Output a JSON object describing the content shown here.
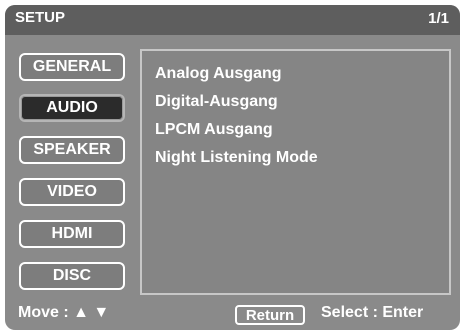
{
  "header": {
    "title": "SETUP",
    "page_indicator": "1/1"
  },
  "menu": {
    "items": [
      {
        "label": "GENERAL",
        "active": false
      },
      {
        "label": "AUDIO",
        "active": true
      },
      {
        "label": "SPEAKER",
        "active": false
      },
      {
        "label": "VIDEO",
        "active": false
      },
      {
        "label": "HDMI",
        "active": false
      },
      {
        "label": "DISC",
        "active": false
      }
    ]
  },
  "content": {
    "options": [
      "Analog Ausgang",
      "Digital-Ausgang",
      "LPCM Ausgang",
      "Night Listening Mode"
    ]
  },
  "footer": {
    "move_label": "Move : ▲ ▼",
    "return_label": "Return",
    "select_label": "Select :  Enter"
  },
  "colors": {
    "panel": "#8a8a8a",
    "titlebar": "#5e5e5e",
    "active_item": "#2b2b2b",
    "text": "#ffffff"
  }
}
